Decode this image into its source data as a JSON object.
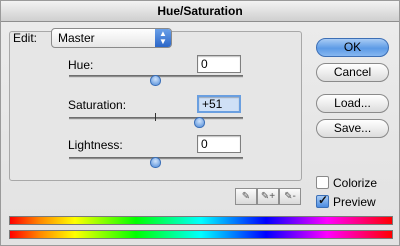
{
  "window": {
    "title": "Hue/Saturation"
  },
  "edit": {
    "label": "Edit:",
    "selected": "Master"
  },
  "hue": {
    "label": "Hue:",
    "value": "0",
    "slider_level": 0.5
  },
  "saturation": {
    "label": "Saturation:",
    "value": "+51",
    "slider_level": 0.75
  },
  "lightness": {
    "label": "Lightness:",
    "value": "0",
    "slider_level": 0.5
  },
  "buttons": {
    "ok": "OK",
    "cancel": "Cancel",
    "load": "Load...",
    "save": "Save..."
  },
  "colorize": {
    "label": "Colorize",
    "checked": false
  },
  "preview": {
    "label": "Preview",
    "checked": true
  },
  "icons": [
    "eyedropper-icon",
    "eyedropper-plus-icon",
    "eyedropper-minus-icon",
    "popup-arrows-icon",
    "checkmark-icon"
  ],
  "colors": {
    "accent": "#5d9be6",
    "field_highlight": "#cfe0f6"
  }
}
